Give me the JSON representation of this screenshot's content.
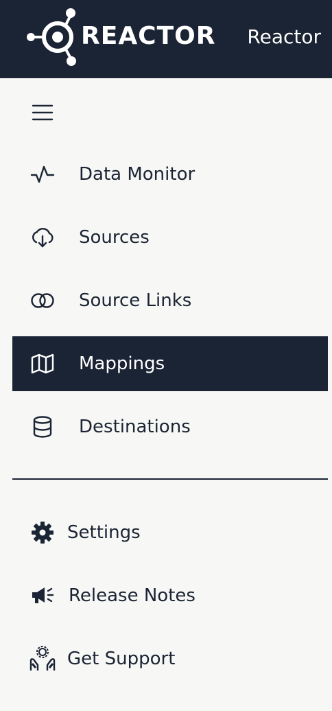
{
  "header": {
    "brand": "REACTOR",
    "app_name": "Reactor",
    "background": "#1b2434"
  },
  "menu": {
    "toggle_icon": "hamburger-icon"
  },
  "nav": {
    "items": [
      {
        "label": "Data Monitor",
        "icon": "pulse-icon",
        "active": false
      },
      {
        "label": "Sources",
        "icon": "cloud-download-icon",
        "active": false
      },
      {
        "label": "Source Links",
        "icon": "link-icon",
        "active": false
      },
      {
        "label": "Mappings",
        "icon": "map-icon",
        "active": true
      },
      {
        "label": "Destinations",
        "icon": "database-icon",
        "active": false
      }
    ]
  },
  "footer": {
    "items": [
      {
        "label": "Settings",
        "icon": "gear-icon"
      },
      {
        "label": "Release Notes",
        "icon": "megaphone-icon"
      },
      {
        "label": "Get Support",
        "icon": "support-hands-icon"
      }
    ]
  },
  "colors": {
    "accent": "#1b2434",
    "background": "#f7f7f5",
    "text": "#1b2434"
  }
}
